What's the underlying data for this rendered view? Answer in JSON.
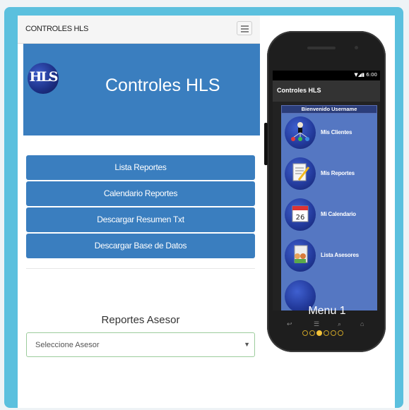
{
  "navbar": {
    "brand": "CONTROLES HLS",
    "menu_icon": "hamburger-icon"
  },
  "hero": {
    "logo_text": "HLS",
    "title": "Controles HLS"
  },
  "menu": {
    "items": [
      {
        "label": "Lista Reportes"
      },
      {
        "label": "Calendario Reportes"
      },
      {
        "label": "Descargar Resumen Txt"
      },
      {
        "label": "Descargar Base de Datos"
      }
    ]
  },
  "reportes": {
    "title": "Reportes Asesor",
    "select_value": "Seleccione Asesor"
  },
  "phone": {
    "status_icons": "▼◢▮ 6:00",
    "app_title": "Controles HLS",
    "welcome": "Bienvenido Username",
    "items": [
      {
        "label": "Mis Clientes",
        "icon": "people-network-icon"
      },
      {
        "label": "Mis Reportes",
        "icon": "report-edit-icon"
      },
      {
        "label": "Mi Calendario",
        "icon": "calendar-icon",
        "icon_text": "26"
      },
      {
        "label": "Lista Asesores",
        "icon": "team-list-icon"
      }
    ],
    "caption": "Menu 1",
    "page_dots": {
      "count": 6,
      "active": 2
    }
  },
  "colors": {
    "frame": "#5bc0de",
    "primary": "#3a7ebf",
    "phone_list_bg": "#5577c2",
    "dot_active": "#f2c23a"
  }
}
